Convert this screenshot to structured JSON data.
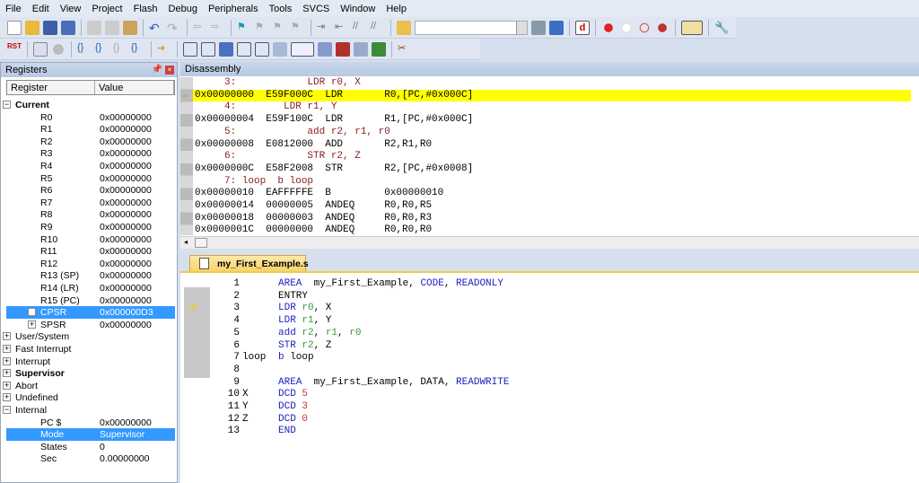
{
  "menu": [
    "File",
    "Edit",
    "View",
    "Project",
    "Flash",
    "Debug",
    "Peripherals",
    "Tools",
    "SVCS",
    "Window",
    "Help"
  ],
  "registers": {
    "title": "Registers",
    "col_register": "Register",
    "col_value": "Value",
    "current_label": "Current",
    "current": [
      {
        "name": "R0",
        "value": "0x00000000"
      },
      {
        "name": "R1",
        "value": "0x00000000"
      },
      {
        "name": "R2",
        "value": "0x00000000"
      },
      {
        "name": "R3",
        "value": "0x00000000"
      },
      {
        "name": "R4",
        "value": "0x00000000"
      },
      {
        "name": "R5",
        "value": "0x00000000"
      },
      {
        "name": "R6",
        "value": "0x00000000"
      },
      {
        "name": "R7",
        "value": "0x00000000"
      },
      {
        "name": "R8",
        "value": "0x00000000"
      },
      {
        "name": "R9",
        "value": "0x00000000"
      },
      {
        "name": "R10",
        "value": "0x00000000"
      },
      {
        "name": "R11",
        "value": "0x00000000"
      },
      {
        "name": "R12",
        "value": "0x00000000"
      },
      {
        "name": "R13 (SP)",
        "value": "0x00000000"
      },
      {
        "name": "R14 (LR)",
        "value": "0x00000000"
      },
      {
        "name": "R15 (PC)",
        "value": "0x00000000"
      },
      {
        "name": "CPSR",
        "value": "0x000000D3"
      },
      {
        "name": "SPSR",
        "value": "0x00000000"
      }
    ],
    "groups": [
      "User/System",
      "Fast Interrupt",
      "Interrupt",
      "Supervisor",
      "Abort",
      "Undefined",
      "Internal"
    ],
    "internal": [
      {
        "name": "PC  $",
        "value": "0x00000000"
      },
      {
        "name": "Mode",
        "value": "Supervisor"
      },
      {
        "name": "States",
        "value": "0"
      },
      {
        "name": "Sec",
        "value": "0.00000000"
      }
    ]
  },
  "disassembly": {
    "title": "Disassembly",
    "lines": [
      {
        "type": "src",
        "text": "     3:            LDR r0, X"
      },
      {
        "type": "asm",
        "text": "0x00000000  E59F000C  LDR       R0,[PC,#0x000C]",
        "current": true
      },
      {
        "type": "src",
        "text": "     4:        LDR r1, Y"
      },
      {
        "type": "asm",
        "text": "0x00000004  E59F100C  LDR       R1,[PC,#0x000C]"
      },
      {
        "type": "src",
        "text": "     5:            add r2, r1, r0"
      },
      {
        "type": "asm",
        "text": "0x00000008  E0812000  ADD       R2,R1,R0"
      },
      {
        "type": "src",
        "text": "     6:            STR r2, Z"
      },
      {
        "type": "asm",
        "text": "0x0000000C  E58F2008  STR       R2,[PC,#0x0008]"
      },
      {
        "type": "src",
        "text": "     7: loop  b loop"
      },
      {
        "type": "asm",
        "text": "0x00000010  EAFFFFFE  B         0x00000010"
      },
      {
        "type": "asm",
        "text": "0x00000014  00000005  ANDEQ     R0,R0,R5"
      },
      {
        "type": "asm",
        "text": "0x00000018  00000003  ANDEQ     R0,R0,R3"
      },
      {
        "type": "asm",
        "text": "0x0000001C  00000000  ANDEQ     R0,R0,R0"
      }
    ]
  },
  "editor": {
    "tab": "my_First_Example.s",
    "lines": [
      {
        "no": "1",
        "label": "",
        "tokens": [
          [
            "kw",
            "AREA"
          ],
          [
            "",
            "  my_First_Example, "
          ],
          [
            "kw",
            "CODE"
          ],
          [
            "",
            ", "
          ],
          [
            "kw",
            "READONLY"
          ]
        ]
      },
      {
        "no": "2",
        "label": "",
        "tokens": [
          [
            "",
            "ENTRY"
          ]
        ]
      },
      {
        "no": "3",
        "label": "",
        "tokens": [
          [
            "kw",
            "LDR "
          ],
          [
            "rg",
            "r0"
          ],
          [
            "",
            ", X"
          ]
        ]
      },
      {
        "no": "4",
        "label": "",
        "tokens": [
          [
            "kw",
            "LDR "
          ],
          [
            "rg",
            "r1"
          ],
          [
            "",
            ", Y"
          ]
        ]
      },
      {
        "no": "5",
        "label": "",
        "tokens": [
          [
            "kw",
            "add "
          ],
          [
            "rg",
            "r2"
          ],
          [
            "",
            ", "
          ],
          [
            "rg",
            "r1"
          ],
          [
            "",
            ", "
          ],
          [
            "rg",
            "r0"
          ]
        ]
      },
      {
        "no": "6",
        "label": "",
        "tokens": [
          [
            "kw",
            "STR "
          ],
          [
            "rg",
            "r2"
          ],
          [
            "",
            ", Z"
          ]
        ]
      },
      {
        "no": "7",
        "label": "loop",
        "tokens": [
          [
            "kw",
            "b"
          ],
          [
            "",
            " loop"
          ]
        ]
      },
      {
        "no": "8",
        "label": "",
        "tokens": []
      },
      {
        "no": "9",
        "label": "",
        "tokens": [
          [
            "kw",
            "AREA"
          ],
          [
            "",
            "  my_First_Example, DATA, "
          ],
          [
            "kw",
            "READWRITE"
          ]
        ]
      },
      {
        "no": "10",
        "label": "X",
        "tokens": [
          [
            "kw",
            "DCD "
          ],
          [
            "nm",
            "5"
          ]
        ]
      },
      {
        "no": "11",
        "label": "Y",
        "tokens": [
          [
            "kw",
            "DCD "
          ],
          [
            "nm",
            "3"
          ]
        ]
      },
      {
        "no": "12",
        "label": "Z",
        "tokens": [
          [
            "kw",
            "DCD "
          ],
          [
            "nm",
            "0"
          ]
        ]
      },
      {
        "no": "13",
        "label": "",
        "tokens": [
          [
            "kw",
            "END"
          ]
        ]
      }
    ]
  },
  "toolbar": {
    "find_value": ""
  }
}
